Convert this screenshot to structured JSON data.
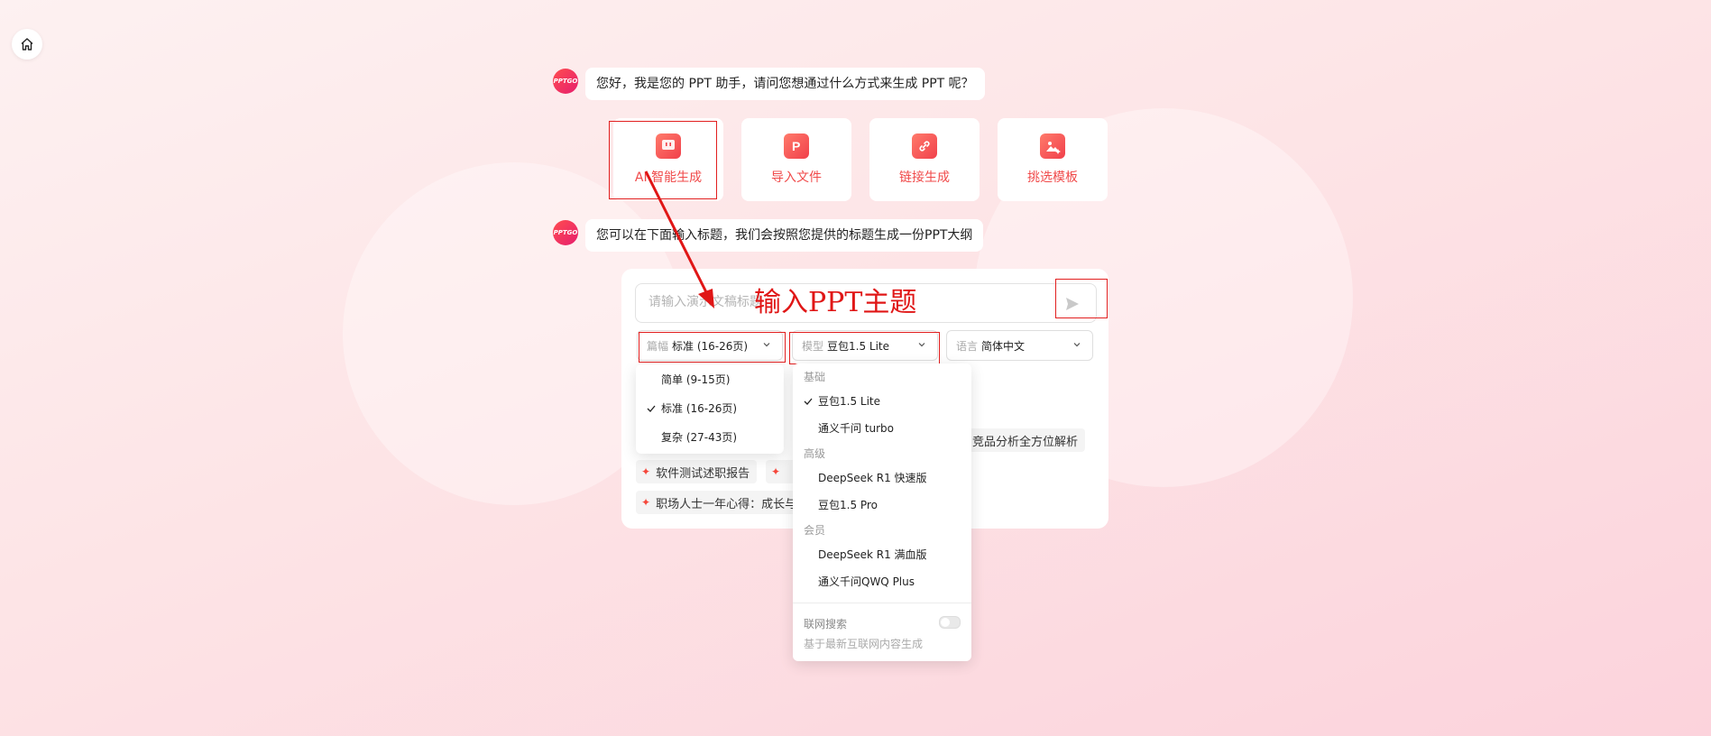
{
  "assistant": {
    "avatar_text": "PPTGO",
    "greeting": "您好，我是您的 PPT 助手，请问您想通过什么方式来生成 PPT 呢？",
    "prompt": "您可以在下面输入标题，我们会按照您提供的标题生成一份PPT大纲"
  },
  "options": [
    {
      "label": "AI 智能生成",
      "icon": "chat-icon"
    },
    {
      "label": "导入文件",
      "icon": "ppt-file-icon"
    },
    {
      "label": "链接生成",
      "icon": "link-icon"
    },
    {
      "label": "挑选模板",
      "icon": "template-image-icon"
    }
  ],
  "input": {
    "placeholder": "请输入演示文稿标题"
  },
  "annotation": "输入PPT主题",
  "selectors": {
    "length": {
      "key": "篇幅",
      "value": "标准 (16-26页)"
    },
    "model": {
      "key": "模型",
      "value": "豆包1.5 Lite"
    },
    "language": {
      "key": "语言",
      "value": "简体中文"
    }
  },
  "length_options": [
    "简单 (9-15页)",
    "标准 (16-26页)",
    "复杂 (27-43页)"
  ],
  "length_selected": "标准 (16-26页)",
  "model_menu": {
    "groups": [
      {
        "name": "基础",
        "items": [
          "豆包1.5 Lite",
          "通义千问 turbo"
        ]
      },
      {
        "name": "高级",
        "items": [
          "DeepSeek R1 快速版",
          "豆包1.5 Pro"
        ]
      },
      {
        "name": "会员",
        "items": [
          "DeepSeek R1 满血版",
          "通义千问QWQ Plus"
        ]
      }
    ],
    "selected": "豆包1.5 Lite",
    "web_search_label": "联网搜索",
    "web_search_desc": "基于最新互联网内容生成",
    "web_search_enabled": false
  },
  "suggestions": {
    "row1_partial_left": "...",
    "row1_right": "竞品分析全方位解析",
    "row2_left": "软件测试述职报告",
    "row3_left": "职场人士一年心得：成长与"
  },
  "colors": {
    "accent": "#f04a4a",
    "annotation": "#e01616"
  }
}
